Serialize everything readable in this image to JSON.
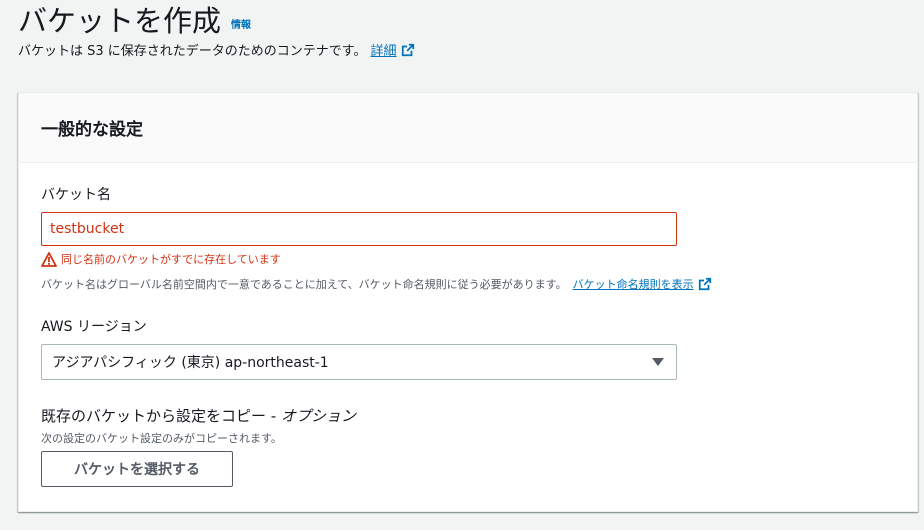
{
  "header": {
    "title": "バケットを作成",
    "info_label": "情報",
    "description": "バケットは S3 に保存されたデータのためのコンテナです。",
    "details_link": "詳細"
  },
  "general": {
    "section_title": "一般的な設定",
    "bucket_name": {
      "label": "バケット名",
      "value": "testbucket",
      "error": "同じ名前のバケットがすでに存在しています",
      "constraint": "バケット名はグローバル名前空間内で一意であることに加えて、バケット命名規則に従う必要があります。",
      "rules_link": "バケット命名規則を表示"
    },
    "region": {
      "label": "AWS リージョン",
      "selected": "アジアパシフィック (東京) ap-northeast-1"
    },
    "copy": {
      "label": "既存のバケットから設定をコピー - ",
      "label_optional": "オプション",
      "hint": "次の設定のバケット設定のみがコピーされます。",
      "button": "バケットを選択する"
    }
  },
  "colors": {
    "error": "#d13212",
    "link": "#0073bb",
    "text": "#16191f",
    "secondary_text": "#545b64"
  },
  "icons": {
    "external": "external-link-icon",
    "warning": "warning-icon",
    "dropdown": "caret-down-icon"
  }
}
